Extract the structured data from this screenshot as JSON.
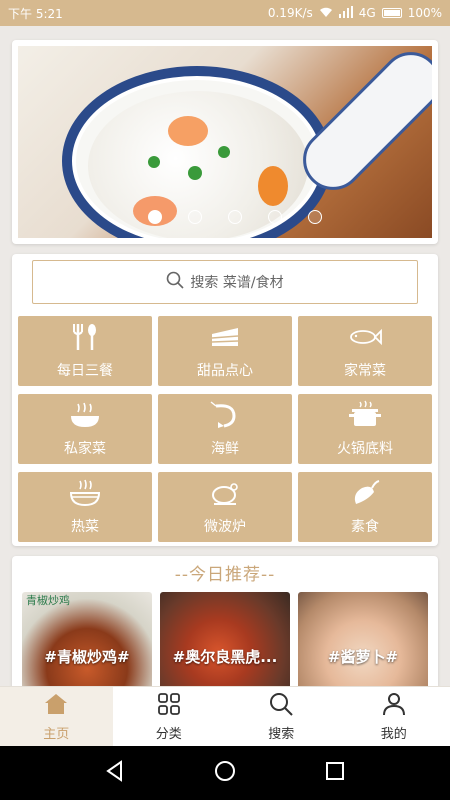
{
  "status": {
    "time": "下午 5:21",
    "speed": "0.19K/s",
    "network": "4G",
    "battery": "100%"
  },
  "banner": {
    "slides": 5,
    "active_index": 0
  },
  "search": {
    "placeholder": "搜索 菜谱/食材"
  },
  "categories": [
    {
      "label": "每日三餐",
      "icon": "fork-spoon-icon"
    },
    {
      "label": "甜品点心",
      "icon": "cake-icon"
    },
    {
      "label": "家常菜",
      "icon": "fish-icon"
    },
    {
      "label": "私家菜",
      "icon": "noodle-bowl-icon"
    },
    {
      "label": "海鲜",
      "icon": "shrimp-icon"
    },
    {
      "label": "火锅底料",
      "icon": "hotpot-icon"
    },
    {
      "label": "热菜",
      "icon": "hot-bowl-icon"
    },
    {
      "label": "微波炉",
      "icon": "chicken-icon"
    },
    {
      "label": "素食",
      "icon": "pepper-icon"
    }
  ],
  "recommend": {
    "title": "--今日推荐--",
    "items": [
      {
        "label": "#青椒炒鸡#",
        "tag": "青椒炒鸡"
      },
      {
        "label": "#奥尔良黑虎..."
      },
      {
        "label": "#酱萝卜#"
      }
    ]
  },
  "tabs": [
    {
      "label": "主页",
      "icon": "home-icon",
      "active": true
    },
    {
      "label": "分类",
      "icon": "grid-icon",
      "active": false
    },
    {
      "label": "搜索",
      "icon": "search-icon",
      "active": false
    },
    {
      "label": "我的",
      "icon": "user-icon",
      "active": false
    }
  ],
  "colors": {
    "accent": "#d6b98f",
    "active_tab": "#c9a06c",
    "title": "#caa77a"
  }
}
